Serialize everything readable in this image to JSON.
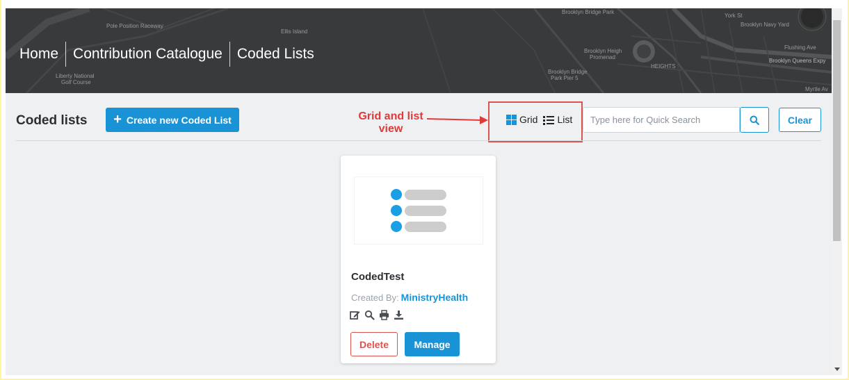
{
  "breadcrumbs": [
    "Home",
    "Contribution Catalogue",
    "Coded Lists"
  ],
  "map_labels": {
    "raceway": "Pole Position Raceway",
    "ellis": "Ellis Island",
    "liberty": "Liberty National",
    "golf": "Golf Course",
    "bbpark": "Brooklyn Bridge Park",
    "york": "York St",
    "navy": "Brooklyn Navy Yard",
    "heights1": "Brooklyn Heigh",
    "heights2": "Promenad",
    "pier1": "Brooklyn Bridge",
    "pier2": "Park Pier 5",
    "flushing": "Flushing Ave",
    "bqe": "Brooklyn Queens Expy",
    "myrtle": "Myrtle Av",
    "hts": "HEIGHTS"
  },
  "page_title": "Coded lists",
  "create_button": "Create new Coded List",
  "annotation": "Grid and list view",
  "view_toggle": {
    "grid": "Grid",
    "list": "List"
  },
  "search": {
    "placeholder": "Type here for Quick Search",
    "value": ""
  },
  "clear_button": "Clear",
  "card": {
    "title": "CodedTest",
    "created_by_label": "Created By:",
    "created_by": "MinistryHealth",
    "delete": "Delete",
    "manage": "Manage",
    "action_icons": [
      "edit-icon",
      "search-icon",
      "print-icon",
      "download-icon"
    ]
  },
  "colors": {
    "primary": "#1a93d6",
    "danger": "#d9534f",
    "annotation": "#e03a3a",
    "thumb_dot": "#1a9ee6"
  }
}
